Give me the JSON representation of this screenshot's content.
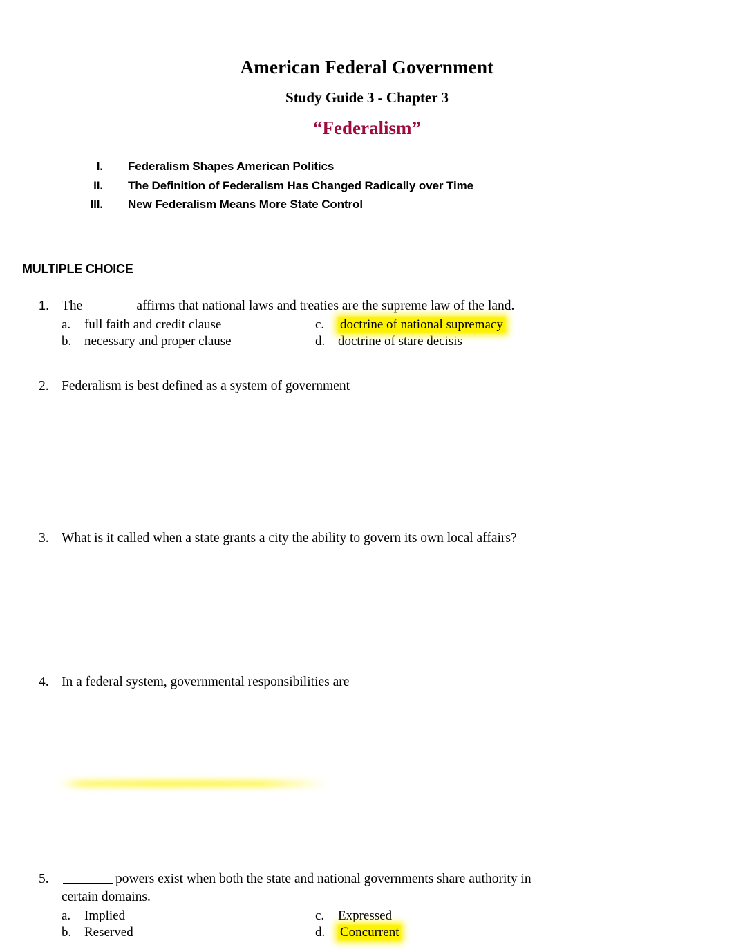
{
  "document": {
    "title": "American Federal Government",
    "subtitle": "Study Guide 3 - Chapter 3",
    "theme": "“Federalism”",
    "theme_color": "#9e0b3d",
    "highlight_color": "#fdf200"
  },
  "outline": {
    "items": [
      {
        "numeral": "I.",
        "text": "Federalism Shapes American Politics"
      },
      {
        "numeral": "II.",
        "text": "The Definition of Federalism Has Changed Radically over Time"
      },
      {
        "numeral": "III.",
        "text": "New Federalism Means More State Control"
      }
    ]
  },
  "section": {
    "heading": "MULTIPLE CHOICE"
  },
  "questions": [
    {
      "number": "1.",
      "stem_before_blank": "The",
      "stem_after_blank": "affirms that national laws and treaties are the supreme law of the land.",
      "has_blank": true,
      "options": [
        {
          "letter": "a.",
          "text": "full faith and credit clause",
          "highlighted": false
        },
        {
          "letter": "b.",
          "text": "necessary and proper clause",
          "highlighted": false
        },
        {
          "letter": "c.",
          "text": "doctrine of national supremacy",
          "highlighted": true
        },
        {
          "letter": "d.",
          "text": "doctrine of stare decisis",
          "highlighted": false
        }
      ]
    },
    {
      "number": "2.",
      "stem_before_blank": "Federalism is best defined as a system of government",
      "stem_after_blank": "",
      "has_blank": false,
      "options": []
    },
    {
      "number": "3.",
      "stem_before_blank": "What is it called when a state grants a city the ability to govern its own local affairs?",
      "stem_after_blank": "",
      "has_blank": false,
      "options": []
    },
    {
      "number": "4.",
      "stem_before_blank": "In a federal system, governmental responsibilities are",
      "stem_after_blank": "",
      "has_blank": false,
      "options": []
    },
    {
      "number": "5.",
      "stem_before_blank": "",
      "stem_after_blank": "powers exist when both the state and national governments share authority in certain domains.",
      "has_blank": true,
      "options": [
        {
          "letter": "a.",
          "text": "Implied",
          "highlighted": false
        },
        {
          "letter": "b.",
          "text": "Reserved",
          "highlighted": false
        },
        {
          "letter": "c.",
          "text": "Expressed",
          "highlighted": false
        },
        {
          "letter": "d.",
          "text": "Concurrent",
          "highlighted": true
        }
      ]
    }
  ]
}
